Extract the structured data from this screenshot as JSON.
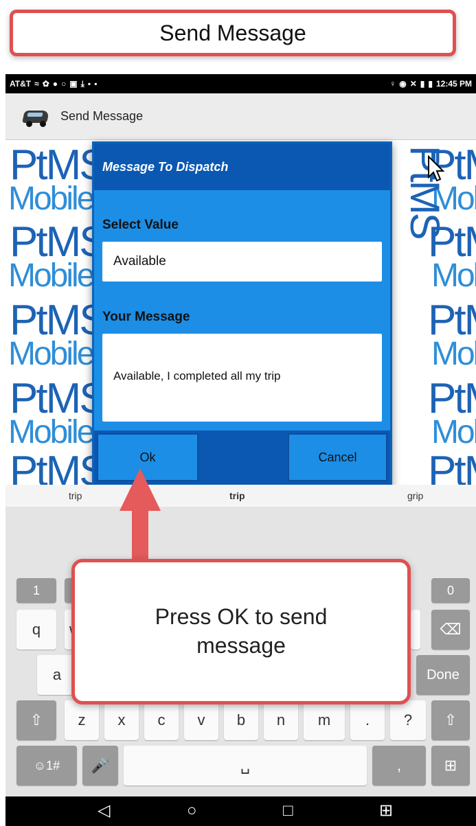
{
  "annotation_top": {
    "text": "Send Message"
  },
  "status_bar": {
    "carrier": "AT&T",
    "left_icons": [
      "wifi-icon",
      "photos-icon",
      "location-icon",
      "circle-icon",
      "screenshot-icon",
      "download-icon",
      "briefcase-icon",
      "briefcase-icon"
    ],
    "right_icons": [
      "location-pin-icon",
      "alarm-icon",
      "mute-icon",
      "signal-icon"
    ],
    "time": "12:45 PM"
  },
  "app_bar": {
    "title": "Send Message",
    "logo": "van-icon"
  },
  "background": {
    "brand_line1": "PtMS",
    "brand_line2": "Mobile"
  },
  "dialog": {
    "title": "Message To Dispatch",
    "select_label": "Select Value",
    "select_value": "Available",
    "message_label": "Your Message",
    "message_value": "Available, I completed all my trip",
    "ok_label": "Ok",
    "cancel_label": "Cancel"
  },
  "suggestions": [
    "trip",
    "trip",
    "grip"
  ],
  "keyboard": {
    "numbers": [
      "1",
      "0"
    ],
    "row1": [
      "q",
      "w"
    ],
    "row2": [
      "a"
    ],
    "row3": [
      "z",
      "x",
      "c",
      "v",
      "b",
      "n",
      "m",
      ".",
      "?"
    ],
    "sym_label": "☺1#",
    "done_label": "Done",
    "comma": ","
  },
  "annotation_bottom": {
    "text": "Press OK to send message"
  },
  "colors": {
    "callout_border": "#e05050",
    "dialog_bg": "#1c8ee6",
    "dialog_header": "#0a58b2",
    "brand_blue": "#1d63b5"
  }
}
